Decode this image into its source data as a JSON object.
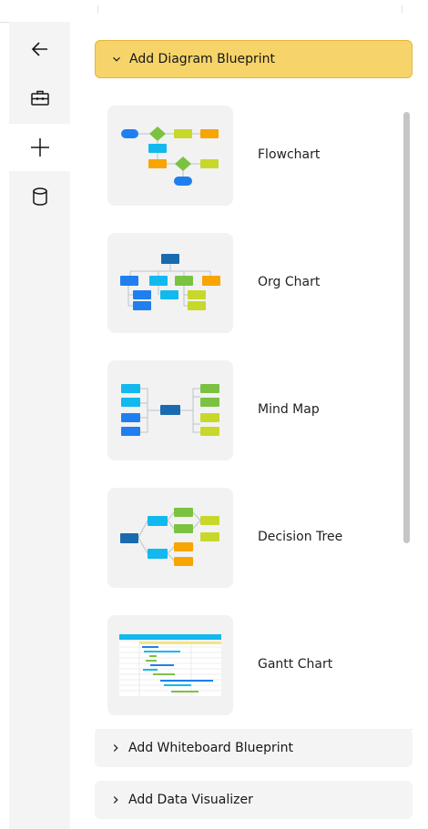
{
  "rail": {
    "items": [
      {
        "icon": "back-arrow-icon"
      },
      {
        "icon": "toolbox-icon"
      },
      {
        "icon": "add-icon"
      },
      {
        "icon": "database-icon"
      }
    ]
  },
  "panel": {
    "diagram_section": {
      "label": "Add Diagram Blueprint",
      "expanded": true,
      "items": [
        {
          "label": "Flowchart",
          "icon": "flowchart-thumbnail"
        },
        {
          "label": "Org Chart",
          "icon": "org-chart-thumbnail"
        },
        {
          "label": "Mind Map",
          "icon": "mind-map-thumbnail"
        },
        {
          "label": "Decision Tree",
          "icon": "decision-tree-thumbnail"
        },
        {
          "label": "Gantt Chart",
          "icon": "gantt-chart-thumbnail"
        }
      ]
    },
    "whiteboard_section": {
      "label": "Add Whiteboard Blueprint",
      "expanded": false
    },
    "visualizer_section": {
      "label": "Add Data Visualizer",
      "expanded": false
    }
  },
  "colors": {
    "accent": "#f6d469",
    "accent_border": "#e7b53b",
    "blue": "#1f7ff0",
    "cyan": "#12b9ee",
    "green": "#7cc242",
    "yellow_green": "#c8d82b",
    "orange": "#f7a500",
    "navy": "#1a6ab0"
  }
}
